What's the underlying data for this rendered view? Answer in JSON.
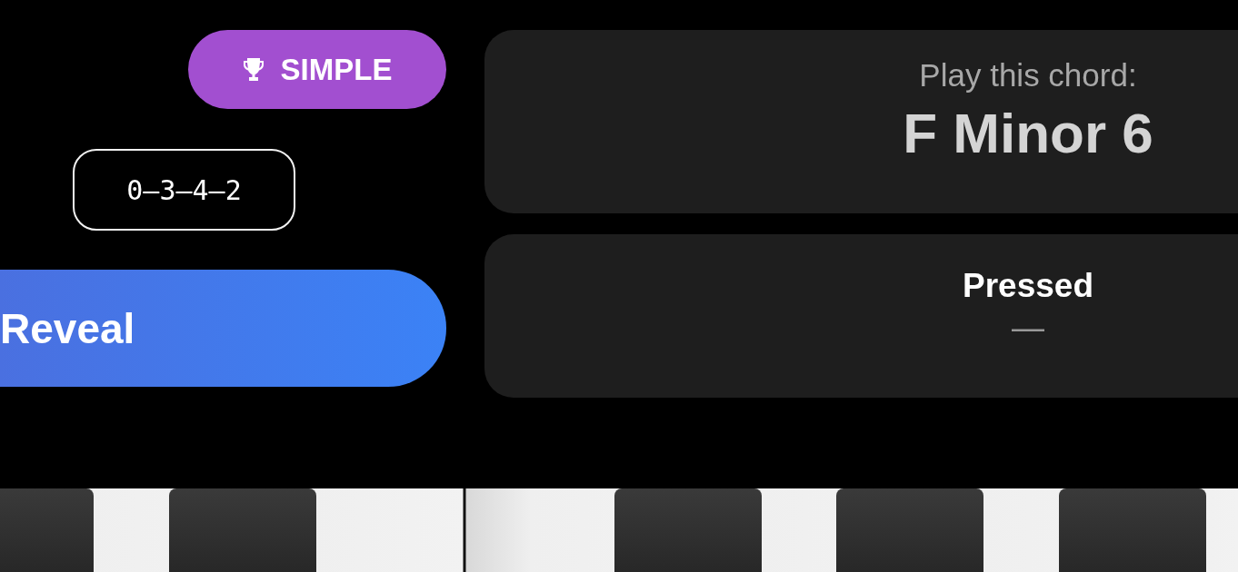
{
  "badge": {
    "label": "SIMPLE"
  },
  "code": "0—3—4—2",
  "reveal_button": {
    "label": "Reveal"
  },
  "prompt": {
    "label": "Play this chord:",
    "chord": "F Minor 6"
  },
  "pressed": {
    "label": "Pressed",
    "value": "—"
  }
}
